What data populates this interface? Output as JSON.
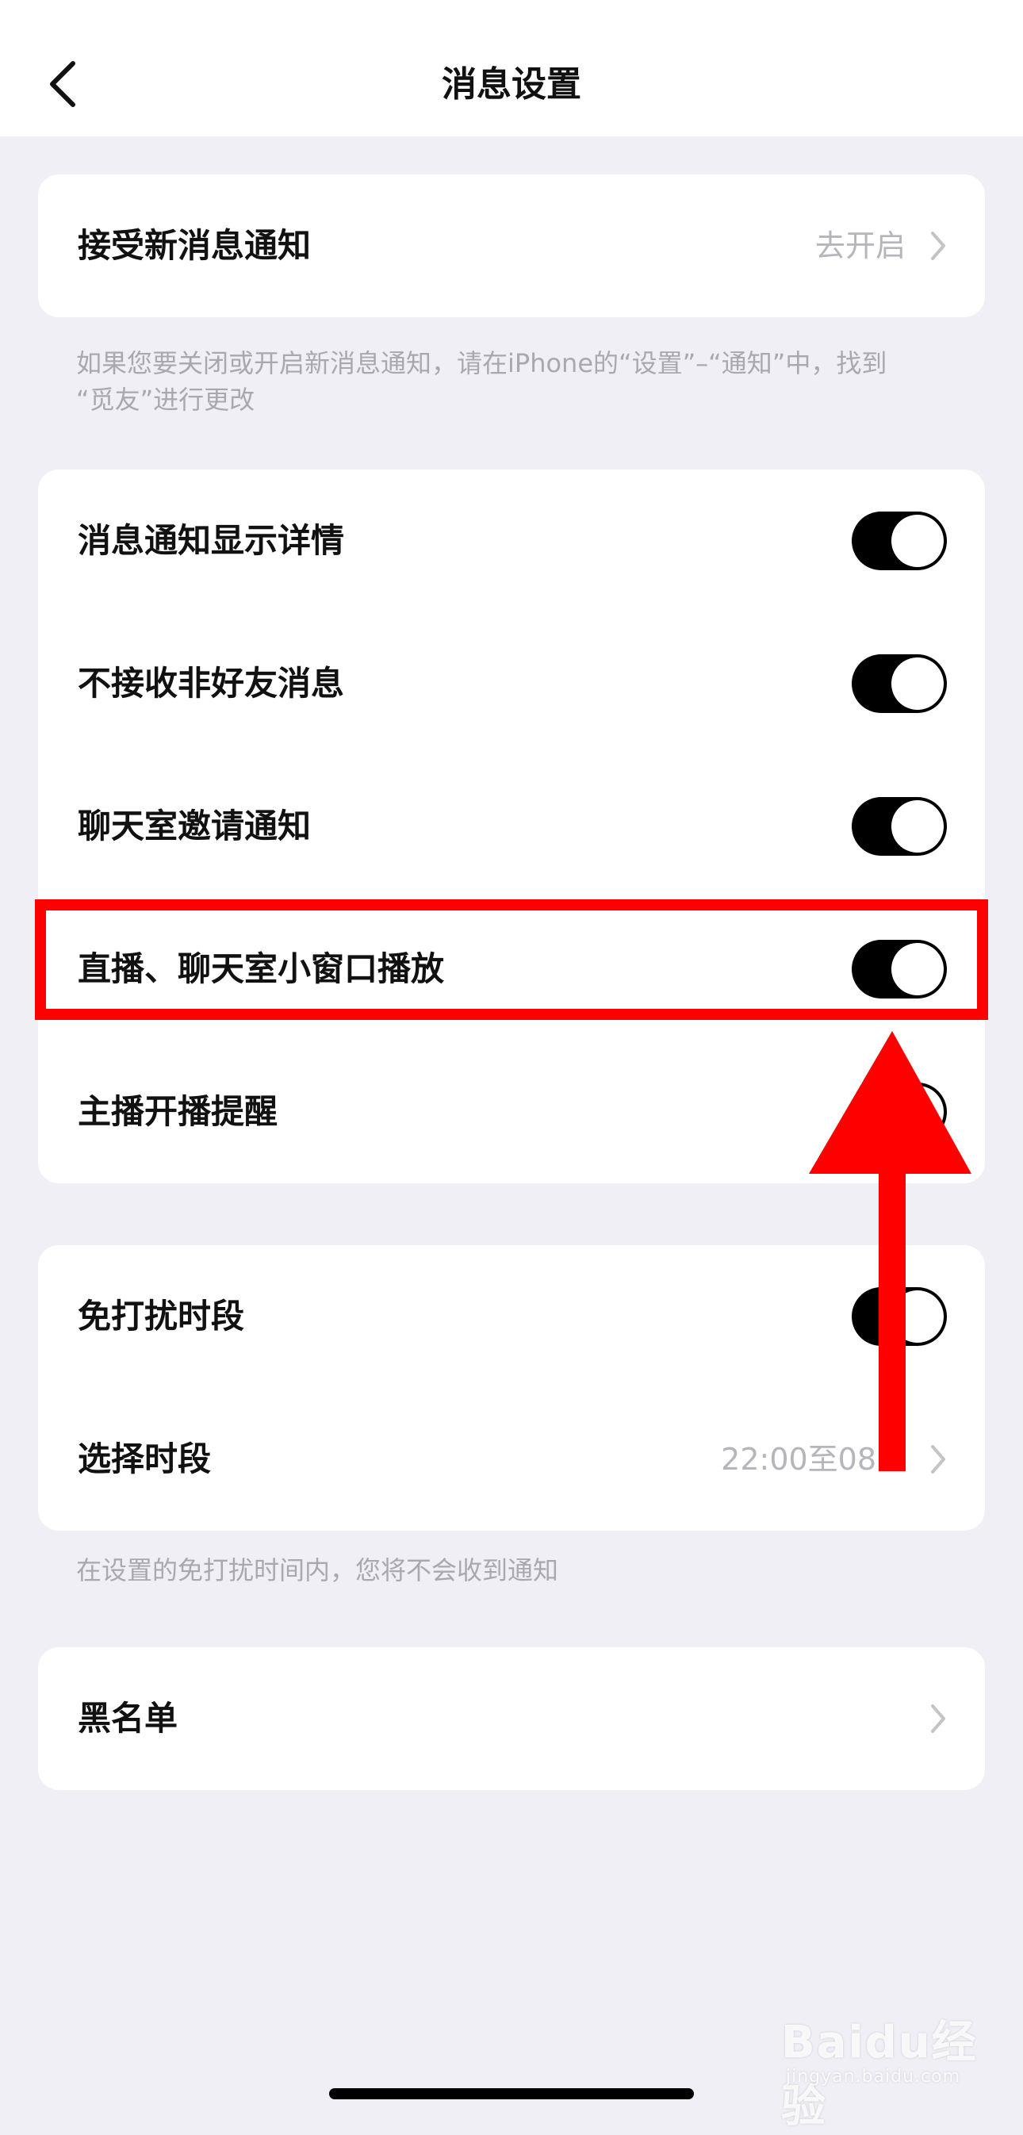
{
  "header": {
    "title": "消息设置",
    "back_icon": "chevron-left-icon"
  },
  "notifications": {
    "label": "接受新消息通知",
    "value": "去开启",
    "footnote_line1": "如果您要关闭或开启新消息通知，请在iPhone的“设置”–“通知”中，找到",
    "footnote_line2": "“觅友”进行更改"
  },
  "toggles": [
    {
      "label": "消息通知显示详情",
      "on": true
    },
    {
      "label": "不接收非好友消息",
      "on": true
    },
    {
      "label": "聊天室邀请通知",
      "on": true
    },
    {
      "label": "直播、聊天室小窗口播放",
      "on": true
    },
    {
      "label": "主播开播提醒",
      "on": true
    }
  ],
  "dnd": {
    "label": "免打扰时段",
    "on": true,
    "period_label": "选择时段",
    "period_value": "22:00至08:0",
    "footnote": "在设置的免打扰时间内，您将不会收到通知"
  },
  "blacklist": {
    "label": "黑名单"
  },
  "annotation": {
    "highlight_color": "#ff0000",
    "arrow_color": "#ff0000"
  },
  "watermark": {
    "main": "Baidu经验",
    "sub": "jingyan.baidu.com"
  },
  "colors": {
    "background": "#efeff5",
    "card": "#ffffff",
    "toggle_on": "#000000",
    "secondary_text": "#b5b5bb",
    "footnote_text": "#a8a8ad"
  }
}
